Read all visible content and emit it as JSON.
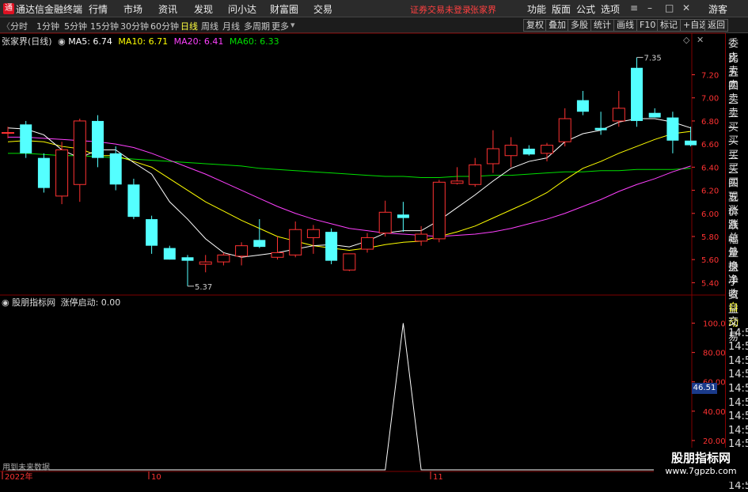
{
  "app": {
    "title": "通达信金融终端",
    "menus": [
      "行情",
      "市场",
      "资讯",
      "发现",
      "问小达",
      "财富圈",
      "交易"
    ],
    "warning": "证券交易未登录",
    "stock_name_top": "张家界",
    "right_menus": [
      "功能",
      "版面",
      "公式",
      "选项"
    ],
    "guest": "游客"
  },
  "toolbar": {
    "periods": [
      "分时",
      "1分钟",
      "5分钟",
      "15分钟",
      "30分钟",
      "60分钟",
      "日线",
      "周线",
      "月线",
      "多周期",
      "更多"
    ],
    "active_period": "日线",
    "right_buttons": [
      "复权",
      "叠加",
      "多股",
      "统计",
      "画线",
      "F10",
      "标记",
      "+自选",
      "返回"
    ]
  },
  "main_chart": {
    "stock_label": "张家界(日线)",
    "ma5_label": "MA5: 6.74",
    "ma10_label": "MA10: 6.71",
    "ma20_label": "MA20: 6.41",
    "ma60_label": "MA60: 6.33",
    "high_label": "7.35",
    "low_label": "5.37",
    "y_ticks": [
      "7.20",
      "7.00",
      "6.80",
      "6.60",
      "6.40",
      "6.20",
      "6.00",
      "5.80",
      "5.60",
      "5.40"
    ]
  },
  "sub_chart": {
    "indicator_name": "股朋指标网",
    "indicator_value": "涨停启动: 0.00",
    "y_ticks": [
      "100.0",
      "80.00",
      "60.00",
      "40.00",
      "20.00"
    ],
    "current_value": "46.51",
    "footer_note": "用到未来数据"
  },
  "x_axis": {
    "labels": [
      "2022年",
      "10",
      "11"
    ]
  },
  "side_panel": {
    "items": [
      "委比",
      "卖五",
      "卖四",
      "卖三",
      "卖二",
      "卖一",
      "买一",
      "买二",
      "买三",
      "买四",
      "买五",
      "现价",
      "涨跌",
      "涨幅",
      "总量",
      "外盘",
      "换手",
      "净资",
      "收益",
      "自动",
      "交易",
      "14:5",
      "14:5",
      "14:5",
      "14:5",
      "14:5",
      "14:5",
      "14:5",
      "14:5",
      "14:5",
      "14:5",
      "14:5",
      "14:5"
    ]
  },
  "watermark": {
    "line1": "股朋指标网",
    "line2": "www.7gpzb.com"
  },
  "colors": {
    "up": "#ff3232",
    "down": "#54ffff",
    "ma5": "#ffffff",
    "ma10": "#ffff00",
    "ma20": "#ff40ff",
    "ma60": "#00e000",
    "grid": "#800000",
    "axis": "#ff3232"
  },
  "chart_data": {
    "type": "candlestick",
    "candles": [
      {
        "o": 6.7,
        "h": 6.75,
        "l": 6.65,
        "c": 6.7
      },
      {
        "o": 6.77,
        "h": 6.8,
        "l": 6.48,
        "c": 6.52
      },
      {
        "o": 6.48,
        "h": 6.52,
        "l": 6.18,
        "c": 6.22
      },
      {
        "o": 6.15,
        "h": 6.62,
        "l": 6.08,
        "c": 6.55
      },
      {
        "o": 6.25,
        "h": 6.82,
        "l": 6.1,
        "c": 6.8
      },
      {
        "o": 6.8,
        "h": 6.85,
        "l": 6.4,
        "c": 6.48
      },
      {
        "o": 6.52,
        "h": 6.58,
        "l": 6.2,
        "c": 6.25
      },
      {
        "o": 6.25,
        "h": 6.3,
        "l": 5.95,
        "c": 5.97
      },
      {
        "o": 5.95,
        "h": 5.98,
        "l": 5.65,
        "c": 5.72
      },
      {
        "o": 5.7,
        "h": 5.72,
        "l": 5.6,
        "c": 5.6
      },
      {
        "o": 5.62,
        "h": 5.64,
        "l": 5.37,
        "c": 5.59
      },
      {
        "o": 5.56,
        "h": 5.64,
        "l": 5.49,
        "c": 5.58
      },
      {
        "o": 5.58,
        "h": 5.66,
        "l": 5.55,
        "c": 5.64
      },
      {
        "o": 5.63,
        "h": 5.75,
        "l": 5.55,
        "c": 5.72
      },
      {
        "o": 5.77,
        "h": 5.95,
        "l": 5.7,
        "c": 5.71
      },
      {
        "o": 5.62,
        "h": 5.8,
        "l": 5.6,
        "c": 5.66
      },
      {
        "o": 5.64,
        "h": 5.93,
        "l": 5.62,
        "c": 5.86
      },
      {
        "o": 5.79,
        "h": 5.9,
        "l": 5.65,
        "c": 5.86
      },
      {
        "o": 5.84,
        "h": 5.87,
        "l": 5.56,
        "c": 5.59
      },
      {
        "o": 5.51,
        "h": 5.65,
        "l": 5.5,
        "c": 5.65
      },
      {
        "o": 5.69,
        "h": 5.83,
        "l": 5.66,
        "c": 5.79
      },
      {
        "o": 5.83,
        "h": 6.11,
        "l": 5.8,
        "c": 6.01
      },
      {
        "o": 5.99,
        "h": 6.1,
        "l": 5.84,
        "c": 5.96
      },
      {
        "o": 5.76,
        "h": 5.89,
        "l": 5.72,
        "c": 5.82
      },
      {
        "o": 5.78,
        "h": 6.29,
        "l": 5.75,
        "c": 6.27
      },
      {
        "o": 6.26,
        "h": 6.4,
        "l": 6.25,
        "c": 6.28
      },
      {
        "o": 6.25,
        "h": 6.48,
        "l": 6.23,
        "c": 6.42
      },
      {
        "o": 6.43,
        "h": 6.72,
        "l": 6.35,
        "c": 6.56
      },
      {
        "o": 6.5,
        "h": 6.66,
        "l": 6.4,
        "c": 6.59
      },
      {
        "o": 6.56,
        "h": 6.59,
        "l": 6.5,
        "c": 6.51
      },
      {
        "o": 6.52,
        "h": 6.61,
        "l": 6.45,
        "c": 6.59
      },
      {
        "o": 6.62,
        "h": 6.91,
        "l": 6.58,
        "c": 6.82
      },
      {
        "o": 6.98,
        "h": 7.06,
        "l": 6.85,
        "c": 6.88
      },
      {
        "o": 6.74,
        "h": 6.88,
        "l": 6.68,
        "c": 6.72
      },
      {
        "o": 6.8,
        "h": 7.06,
        "l": 6.75,
        "c": 6.91
      },
      {
        "o": 7.26,
        "h": 7.35,
        "l": 6.75,
        "c": 6.8
      },
      {
        "o": 6.87,
        "h": 6.91,
        "l": 6.83,
        "c": 6.83
      },
      {
        "o": 6.83,
        "h": 6.88,
        "l": 6.52,
        "c": 6.63
      },
      {
        "o": 6.63,
        "h": 6.75,
        "l": 6.58,
        "c": 6.59
      }
    ],
    "ma5": [
      6.74,
      6.73,
      6.68,
      6.55,
      6.48,
      6.55,
      6.55,
      6.44,
      6.34,
      6.1,
      5.95,
      5.78,
      5.66,
      5.62,
      5.64,
      5.66,
      5.69,
      5.72,
      5.73,
      5.71,
      5.76,
      5.83,
      5.85,
      5.85,
      5.94,
      6.05,
      6.16,
      6.28,
      6.39,
      6.45,
      6.48,
      6.62,
      6.69,
      6.72,
      6.79,
      6.82,
      6.82,
      6.79,
      6.74
    ],
    "ma10": [
      6.62,
      6.63,
      6.62,
      6.58,
      6.56,
      6.5,
      6.5,
      6.45,
      6.4,
      6.3,
      6.2,
      6.1,
      6.02,
      5.94,
      5.87,
      5.8,
      5.76,
      5.72,
      5.7,
      5.68,
      5.7,
      5.73,
      5.75,
      5.76,
      5.8,
      5.84,
      5.89,
      5.96,
      6.03,
      6.1,
      6.18,
      6.29,
      6.39,
      6.45,
      6.52,
      6.58,
      6.64,
      6.69,
      6.71
    ],
    "ma20": [
      6.66,
      6.66,
      6.65,
      6.64,
      6.63,
      6.62,
      6.6,
      6.57,
      6.52,
      6.46,
      6.4,
      6.34,
      6.27,
      6.2,
      6.13,
      6.06,
      6.0,
      5.95,
      5.91,
      5.87,
      5.85,
      5.83,
      5.82,
      5.81,
      5.8,
      5.81,
      5.82,
      5.84,
      5.87,
      5.91,
      5.95,
      6.0,
      6.06,
      6.12,
      6.19,
      6.25,
      6.3,
      6.36,
      6.41
    ],
    "ma60": [
      6.52,
      6.52,
      6.51,
      6.5,
      6.5,
      6.49,
      6.48,
      6.47,
      6.46,
      6.45,
      6.44,
      6.43,
      6.42,
      6.41,
      6.39,
      6.38,
      6.37,
      6.36,
      6.35,
      6.34,
      6.33,
      6.32,
      6.32,
      6.31,
      6.31,
      6.32,
      6.32,
      6.33,
      6.33,
      6.34,
      6.35,
      6.36,
      6.36,
      6.37,
      6.37,
      6.38,
      6.38,
      6.38,
      6.39
    ],
    "indicator": [
      0,
      0,
      0,
      0,
      0,
      0,
      0,
      0,
      0,
      0,
      0,
      0,
      0,
      0,
      0,
      0,
      0,
      0,
      0,
      0,
      0,
      0,
      100,
      0,
      0,
      0,
      0,
      0,
      0,
      0,
      0,
      0,
      0,
      0,
      0,
      0,
      0,
      0,
      0
    ],
    "ylim": [
      5.3,
      7.45
    ],
    "sub_ylim": [
      0,
      110
    ]
  }
}
